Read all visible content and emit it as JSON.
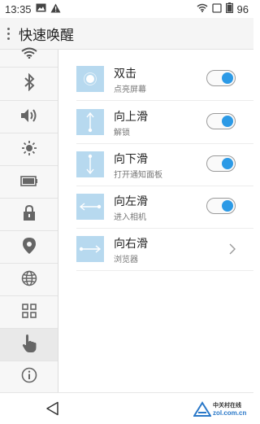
{
  "status_bar": {
    "time": "13:35",
    "battery_level": "96",
    "icons": [
      "image-icon",
      "warning-icon",
      "wifi-icon",
      "sim-icon",
      "battery-icon"
    ]
  },
  "app_bar": {
    "title": "快速唤醒"
  },
  "sidebar": {
    "items": [
      {
        "icon": "wifi-icon"
      },
      {
        "icon": "bluetooth-icon"
      },
      {
        "icon": "volume-icon"
      },
      {
        "icon": "brightness-icon"
      },
      {
        "icon": "battery-icon"
      },
      {
        "icon": "lock-icon"
      },
      {
        "icon": "location-icon"
      },
      {
        "icon": "globe-icon"
      },
      {
        "icon": "apps-grid-icon"
      },
      {
        "icon": "hand-gesture-icon",
        "selected": true
      },
      {
        "icon": "info-icon"
      }
    ]
  },
  "gestures": [
    {
      "title": "双击",
      "subtitle": "点亮屏幕",
      "icon": "double-tap-icon",
      "control": "toggle",
      "enabled": true
    },
    {
      "title": "向上滑",
      "subtitle": "解锁",
      "icon": "swipe-up-icon",
      "control": "toggle",
      "enabled": true
    },
    {
      "title": "向下滑",
      "subtitle": "打开通知面板",
      "icon": "swipe-down-icon",
      "control": "toggle",
      "enabled": true
    },
    {
      "title": "向左滑",
      "subtitle": "进入相机",
      "icon": "swipe-left-icon",
      "control": "toggle",
      "enabled": true
    },
    {
      "title": "向右滑",
      "subtitle": "浏览器",
      "icon": "swipe-right-icon",
      "control": "chevron"
    }
  ],
  "watermark": {
    "top": "中关村在线",
    "bottom": "zol.com.cn"
  },
  "colors": {
    "accent": "#2c9ae6",
    "gesture_icon_bg": "#b7d9ef",
    "active_sidebar": "#e9e9e9"
  }
}
